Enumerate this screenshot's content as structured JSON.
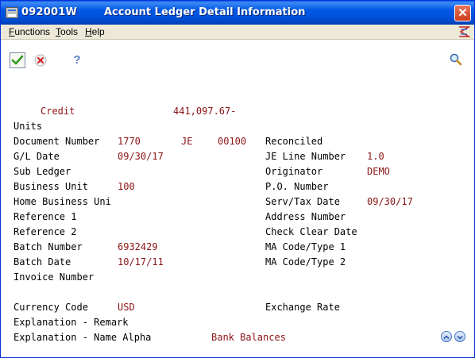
{
  "window": {
    "program_id": "092001W",
    "title": "Account Ledger Detail Information",
    "close_label": "✕"
  },
  "menu": {
    "items": [
      {
        "label": "Functions",
        "underline": "F",
        "rest": "unctions"
      },
      {
        "label": "Tools",
        "underline": "T",
        "rest": "ools"
      },
      {
        "label": "Help",
        "underline": "H",
        "rest": "elp"
      }
    ]
  },
  "toolbar": {
    "ok_icon": "checkmark-icon",
    "cancel_icon": "cancel-icon",
    "help_label": "?",
    "find_icon": "magnifier-icon"
  },
  "form": {
    "credit_label": "Credit",
    "credit_value": "441,097.67-",
    "units_label": "Units",
    "document_number_label": "Document Number",
    "document_number_value": "1770",
    "doc_type_value": "JE",
    "doc_company_value": "00100",
    "reconciled_label": "Reconciled",
    "gl_date_label": "G/L Date",
    "gl_date_value": "09/30/17",
    "je_line_number_label": "JE Line Number",
    "je_line_number_value": "1.0",
    "sub_ledger_label": "Sub Ledger",
    "originator_label": "Originator",
    "originator_value": "DEMO",
    "business_unit_label": "Business Unit",
    "business_unit_value": "100",
    "po_number_label": "P.O. Number",
    "home_business_unit_label": "Home Business Uni",
    "serv_tax_date_label": "Serv/Tax Date",
    "serv_tax_date_value": "09/30/17",
    "reference1_label": "Reference 1",
    "address_number_label": "Address Number",
    "reference2_label": "Reference 2",
    "check_clear_date_label": "Check Clear Date",
    "batch_number_label": "Batch Number",
    "batch_number_value": "6932429",
    "ma_code_type1_label": "MA Code/Type 1",
    "batch_date_label": "Batch Date",
    "batch_date_value": "10/17/11",
    "ma_code_type2_label": "MA Code/Type 2",
    "invoice_number_label": "Invoice Number",
    "currency_code_label": "Currency Code",
    "currency_code_value": "USD",
    "exchange_rate_label": "Exchange Rate",
    "explanation_remark_label": "Explanation - Remark",
    "explanation_name_alpha_label": "Explanation - Name Alpha",
    "explanation_name_alpha_value": "Bank Balances"
  },
  "colors": {
    "title_bar": "#0054e3",
    "value_text": "#8b1414",
    "menubar": "#ece9d8"
  }
}
